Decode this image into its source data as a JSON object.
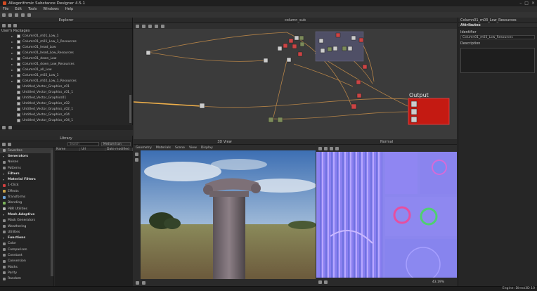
{
  "app": {
    "title": "Allegorithmic Substance Designer 4.5.1"
  },
  "menu": [
    "File",
    "Edit",
    "Tools",
    "Windows",
    "Help"
  ],
  "explorer": {
    "header": "Explorer",
    "packages_label": "User's Packages",
    "items": [
      {
        "label": "Column01_m01_Low_1",
        "kind": "graph",
        "expander": "►"
      },
      {
        "label": "Column01_m01_Low_1_Resources",
        "kind": "graph",
        "expander": "►"
      },
      {
        "label": "Column01_head_Low",
        "kind": "graph",
        "expander": "►"
      },
      {
        "label": "Column01_head_Low_Resources",
        "kind": "graph",
        "expander": "►"
      },
      {
        "label": "Column01_down_Low",
        "kind": "graph",
        "expander": "►"
      },
      {
        "label": "Column01_down_Low_Resources",
        "kind": "graph",
        "expander": "►"
      },
      {
        "label": "Column01_all_Low",
        "kind": "graph",
        "expander": "►"
      },
      {
        "label": "Column01_m02_Low_1",
        "kind": "graph",
        "expander": "►"
      },
      {
        "label": "Column01_m02_Low_1_Resources",
        "kind": "graph",
        "expander": "►"
      },
      {
        "label": "Untitled_Vector_Graphics_c01",
        "kind": "vector",
        "expander": ""
      },
      {
        "label": "Untitled_Vector_Graphics_c01_1",
        "kind": "vector",
        "expander": ""
      },
      {
        "label": "Untitled_Vector_Graphics01",
        "kind": "vector",
        "expander": ""
      },
      {
        "label": "Untitled_Vector_Graphics_c02",
        "kind": "vector",
        "expander": ""
      },
      {
        "label": "Untitled_Vector_Graphics_c02_1",
        "kind": "vector",
        "expander": ""
      },
      {
        "label": "Untitled_Vector_Graphics_c04",
        "kind": "vector",
        "expander": ""
      },
      {
        "label": "Untitled_Vector_Graphics_c04_1",
        "kind": "vector",
        "expander": ""
      }
    ]
  },
  "graph": {
    "header": "column_sub",
    "output_label": "Output"
  },
  "attributes": {
    "tab": "Column01_m03_Low_Resources",
    "section": "Attributes",
    "identifier_label": "Identifier",
    "identifier_value": "Column01_m03_Low_Resources",
    "description_label": "Description"
  },
  "library": {
    "header": "Library",
    "search_placeholder": "Search",
    "icon_size": "Medium Icon",
    "columns": [
      "Name",
      "Url",
      "Date modified"
    ],
    "categories": [
      {
        "label": "Favorites",
        "group": false,
        "selected": true,
        "color": "#9a9a9a"
      },
      {
        "label": "Generators",
        "group": true,
        "selected": false,
        "color": ""
      },
      {
        "label": "Noises",
        "group": false,
        "selected": false,
        "color": "#8a8a8a"
      },
      {
        "label": "Patterns",
        "group": false,
        "selected": false,
        "color": "#8a8a8a"
      },
      {
        "label": "Filters",
        "group": true,
        "selected": false,
        "color": ""
      },
      {
        "label": "Material Filters",
        "group": true,
        "selected": false,
        "color": ""
      },
      {
        "label": "1-Click",
        "group": false,
        "selected": false,
        "color": "#d04040"
      },
      {
        "label": "Effects",
        "group": false,
        "selected": false,
        "color": "#c9a34a"
      },
      {
        "label": "Transforms",
        "group": false,
        "selected": false,
        "color": "#6aa1d6"
      },
      {
        "label": "Blending",
        "group": false,
        "selected": false,
        "color": "#7bb35a"
      },
      {
        "label": "PBR Utilities",
        "group": false,
        "selected": false,
        "color": "#b7b7b7"
      },
      {
        "label": "Mesh Adaptive",
        "group": true,
        "selected": false,
        "color": ""
      },
      {
        "label": "Mask Generators",
        "group": false,
        "selected": false,
        "color": "#8a8a8a"
      },
      {
        "label": "Weathering",
        "group": false,
        "selected": false,
        "color": "#8a8a8a"
      },
      {
        "label": "Utilities",
        "group": false,
        "selected": false,
        "color": "#8a8a8a"
      },
      {
        "label": "Functions",
        "group": true,
        "selected": false,
        "color": ""
      },
      {
        "label": "Color",
        "group": false,
        "selected": false,
        "color": "#8a8a8a"
      },
      {
        "label": "Comparison",
        "group": false,
        "selected": false,
        "color": "#8a8a8a"
      },
      {
        "label": "Constant",
        "group": false,
        "selected": false,
        "color": "#8a8a8a"
      },
      {
        "label": "Conversion",
        "group": false,
        "selected": false,
        "color": "#8a8a8a"
      },
      {
        "label": "Maths",
        "group": false,
        "selected": false,
        "color": "#8a8a8a"
      },
      {
        "label": "Parity",
        "group": false,
        "selected": false,
        "color": "#8a8a8a"
      },
      {
        "label": "Random",
        "group": false,
        "selected": false,
        "color": "#8a8a8a"
      }
    ]
  },
  "view3d": {
    "header": "3D View",
    "menu": [
      "Geometry",
      "Materials",
      "Scene",
      "View",
      "Display"
    ]
  },
  "normal_view": {
    "header": "Normal",
    "zoom": "43.19%"
  },
  "status": {
    "engine": "Engine: Direct3D 10"
  }
}
